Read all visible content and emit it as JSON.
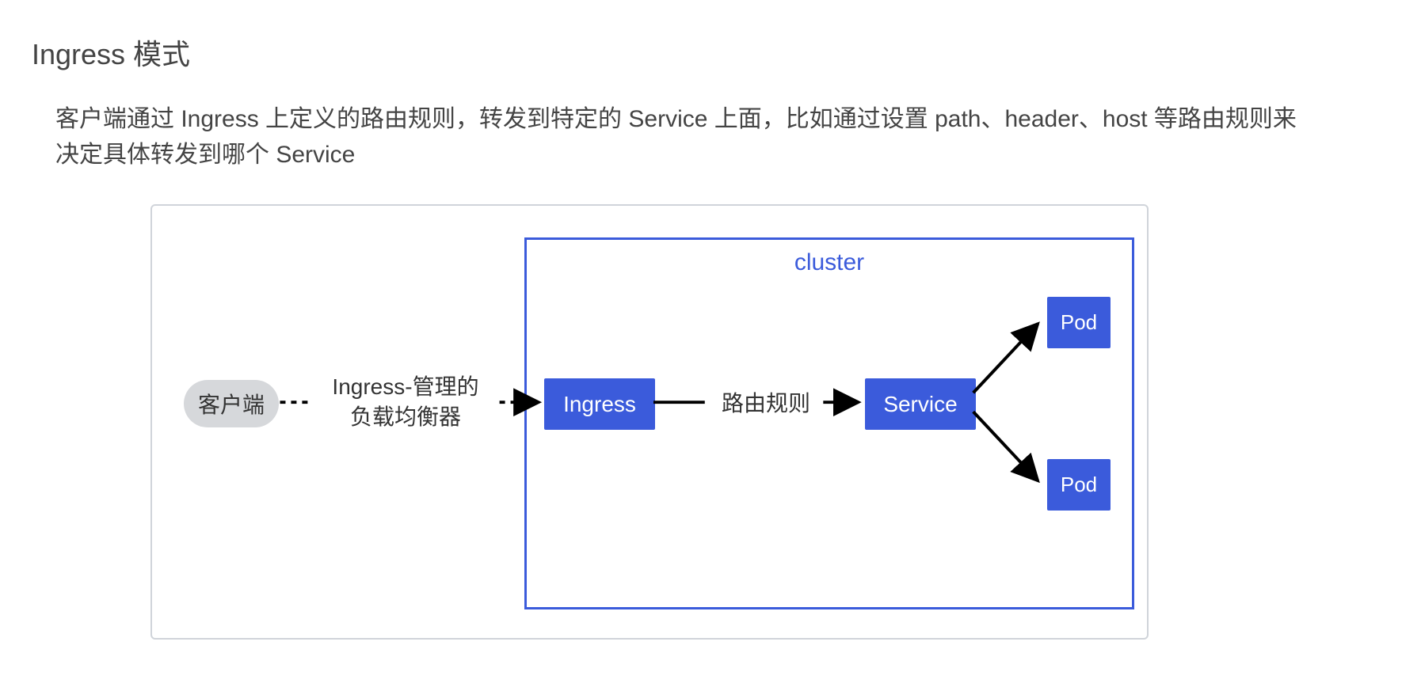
{
  "title": "Ingress 模式",
  "description": "客户端通过 Ingress 上定义的路由规则，转发到特定的 Service 上面，比如通过设置 path、header、host 等路由规则来决定具体转发到哪个 Service",
  "diagram": {
    "cluster_label": "cluster",
    "client_label": "客户端",
    "lb_label_line1": "Ingress-管理的",
    "lb_label_line2": "负载均衡器",
    "ingress_label": "Ingress",
    "route_label": "路由规则",
    "service_label": "Service",
    "pod1_label": "Pod",
    "pod2_label": "Pod"
  }
}
